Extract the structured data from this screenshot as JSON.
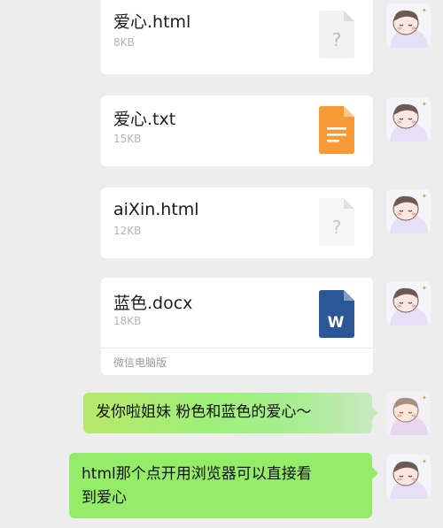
{
  "files": [
    {
      "name": "爱心.html",
      "size": "8KB",
      "type": "unknown"
    },
    {
      "name": "爱心.txt",
      "size": "15KB",
      "type": "text"
    },
    {
      "name": "aiXin.html",
      "size": "12KB",
      "type": "unknown"
    },
    {
      "name": "蓝色.docx",
      "size": "18KB",
      "type": "word",
      "source": "微信电脑版"
    }
  ],
  "messages": [
    {
      "text": "发你啦姐妹 粉色和蓝色的爱心～"
    },
    {
      "text_line1": "html那个点开用浏览器可以直接看",
      "text_line2": "到爱心"
    }
  ],
  "icons": {
    "unknown_glyph": "?",
    "word_glyph": "W"
  },
  "colors": {
    "background": "#ededed",
    "card": "#ffffff",
    "bubble_green": "#95ec69",
    "txt_orange": "#f79a36",
    "word_blue": "#2b5797"
  }
}
